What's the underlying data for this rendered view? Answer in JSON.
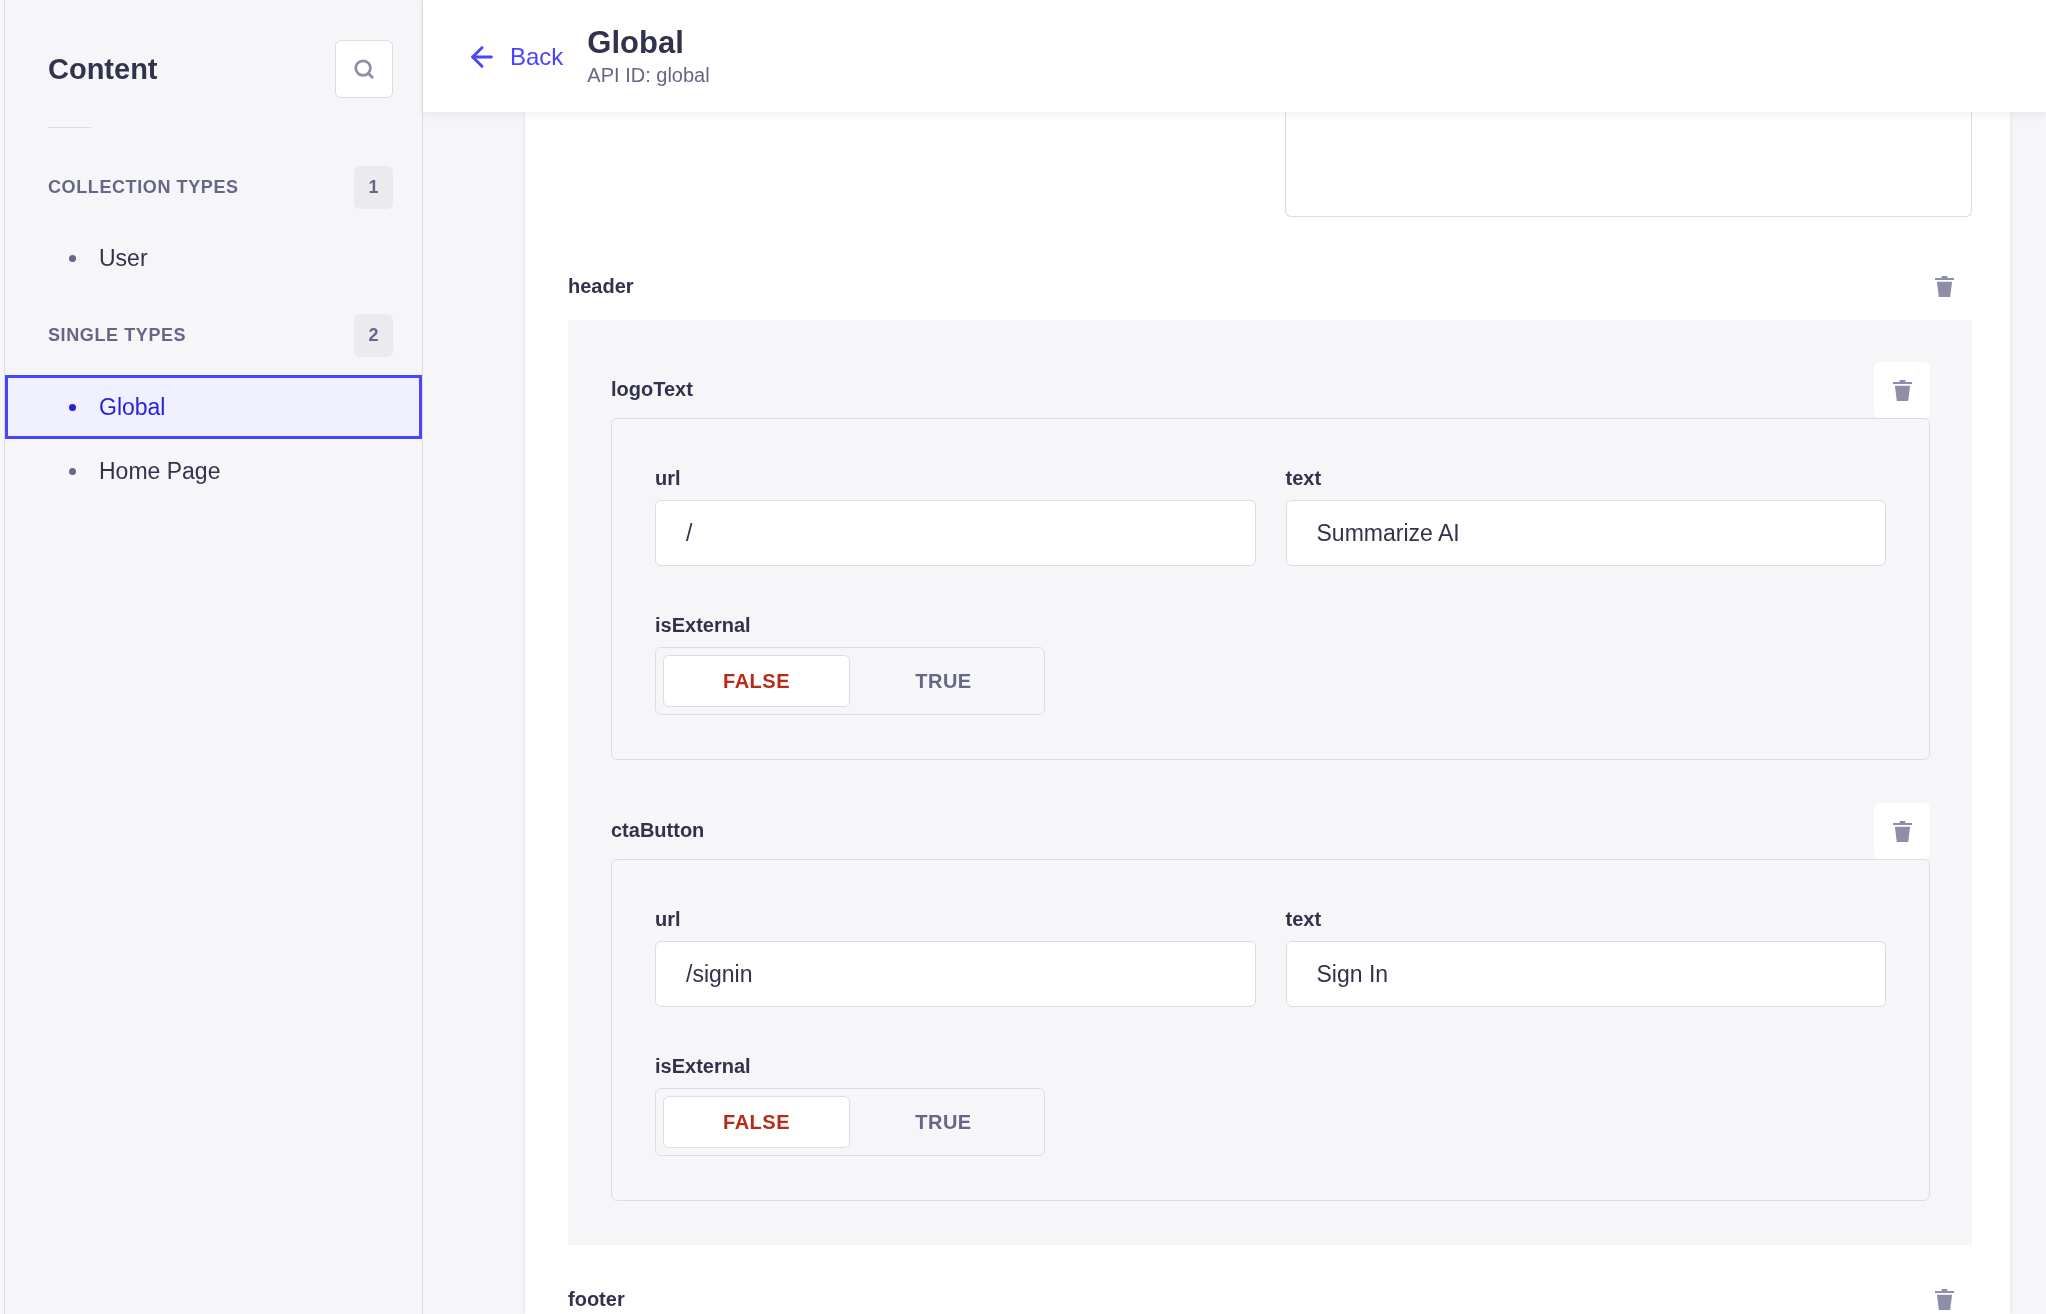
{
  "sidebar": {
    "title": "Content",
    "sections": [
      {
        "heading": "COLLECTION TYPES",
        "count": "1",
        "items": [
          {
            "label": "User",
            "selected": false
          }
        ]
      },
      {
        "heading": "SINGLE TYPES",
        "count": "2",
        "items": [
          {
            "label": "Global",
            "selected": true
          },
          {
            "label": "Home Page",
            "selected": false
          }
        ]
      }
    ]
  },
  "header": {
    "back_label": "Back",
    "title": "Global",
    "subtitle": "API ID: global"
  },
  "form": {
    "components": [
      {
        "label": "header",
        "groups": [
          {
            "label": "logoText",
            "fields": [
              {
                "label": "url",
                "value": "/"
              },
              {
                "label": "text",
                "value": "Summarize AI"
              }
            ],
            "toggle": {
              "label": "isExternal",
              "options": [
                {
                  "label": "FALSE",
                  "selected": true
                },
                {
                  "label": "TRUE",
                  "selected": false
                }
              ]
            }
          },
          {
            "label": "ctaButton",
            "fields": [
              {
                "label": "url",
                "value": "/signin"
              },
              {
                "label": "text",
                "value": "Sign In"
              }
            ],
            "toggle": {
              "label": "isExternal",
              "options": [
                {
                  "label": "FALSE",
                  "selected": true
                },
                {
                  "label": "TRUE",
                  "selected": false
                }
              ]
            }
          }
        ]
      },
      {
        "label": "footer"
      }
    ]
  }
}
